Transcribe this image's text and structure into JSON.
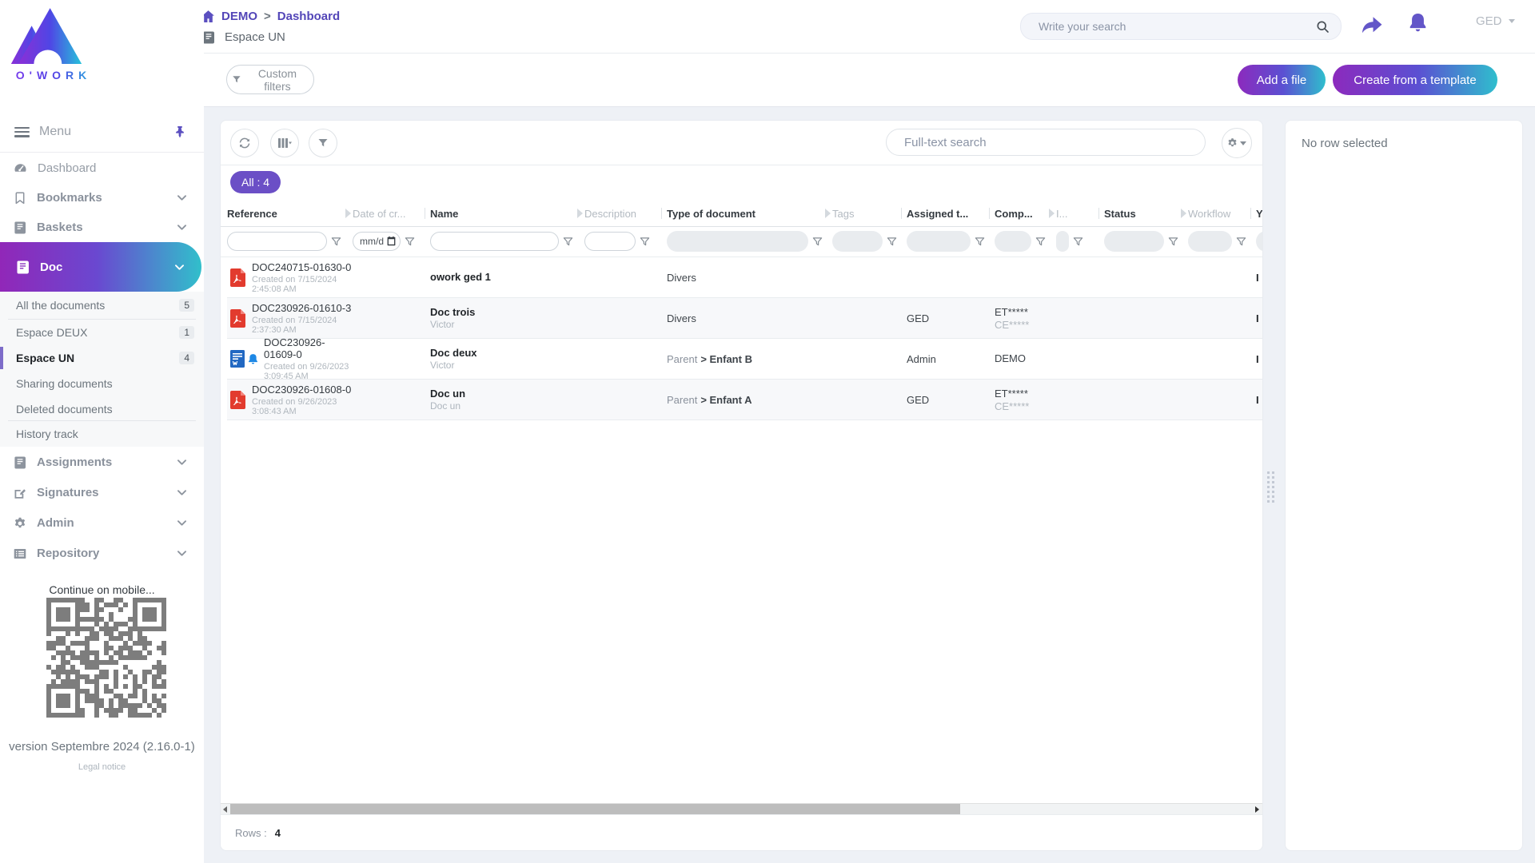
{
  "brand": {
    "name": "O'WORK"
  },
  "header": {
    "breadcrumb_root": "DEMO",
    "breadcrumb_sep": ">",
    "breadcrumb_current": "Dashboard",
    "space_name": "Espace UN",
    "top_search_placeholder": "Write your search",
    "user_menu_label": "GED",
    "custom_filters_label": "Custom filters",
    "add_file_label": "Add a file",
    "create_template_label": "Create from a template"
  },
  "sidebar": {
    "menu_label": "Menu",
    "items": [
      {
        "label": "Dashboard"
      },
      {
        "label": "Bookmarks"
      },
      {
        "label": "Baskets"
      },
      {
        "label": "Doc"
      },
      {
        "label": "Assignments"
      },
      {
        "label": "Signatures"
      },
      {
        "label": "Admin"
      },
      {
        "label": "Repository"
      }
    ],
    "doc_children": [
      {
        "label": "All the documents",
        "badge": "5"
      },
      {
        "label": "Espace DEUX",
        "badge": "1"
      },
      {
        "label": "Espace UN",
        "badge": "4"
      },
      {
        "label": "Sharing documents",
        "badge": ""
      },
      {
        "label": "Deleted documents",
        "badge": ""
      },
      {
        "label": "History track",
        "badge": ""
      }
    ],
    "mobile_text": "Continue on mobile...",
    "version_text": "version Septembre 2024 (2.16.0-1)",
    "legal_text": "Legal notice"
  },
  "toolbar": {
    "fulltext_placeholder": "Full-text search",
    "all_badge": "All : 4"
  },
  "table": {
    "columns": [
      {
        "label": "Reference"
      },
      {
        "label": "Date of cr..."
      },
      {
        "label": "Name"
      },
      {
        "label": "Description"
      },
      {
        "label": "Type of document"
      },
      {
        "label": "Tags"
      },
      {
        "label": "Assigned t..."
      },
      {
        "label": "Comp..."
      },
      {
        "label": "I..."
      },
      {
        "label": "Status"
      },
      {
        "label": "Workflow"
      },
      {
        "label": "Y..."
      }
    ],
    "date_filter_placeholder": "mm/d",
    "rows": [
      {
        "reference": "DOC240715-01630-0",
        "created": "Created on 7/15/2024 2:45:08 AM",
        "name": "owork ged 1",
        "name_sub": "",
        "type_prefix": "",
        "type_main": "Divers",
        "assigned": "",
        "comp_line1": "",
        "comp_line2": "",
        "edge_text": "I",
        "icon": "pdf-file-icon"
      },
      {
        "reference": "DOC230926-01610-3",
        "created": "Created on 7/15/2024 2:37:30 AM",
        "name": "Doc trois",
        "name_sub": "Victor",
        "type_prefix": "",
        "type_main": "Divers",
        "assigned": "GED",
        "comp_line1": "ET*****",
        "comp_line2": "CE*****",
        "edge_text": "I",
        "icon": "pdf-file-icon"
      },
      {
        "reference": "DOC230926-01609-0",
        "created": "Created on 9/26/2023 3:09:45 AM",
        "name": "Doc deux",
        "name_sub": "Victor",
        "type_prefix": "Parent",
        "type_main": "> Enfant B",
        "assigned": "Admin",
        "comp_line1": "DEMO",
        "comp_line2": "",
        "edge_text": "I",
        "icon": "word-file-icon with notification-bell-icon"
      },
      {
        "reference": "DOC230926-01608-0",
        "created": "Created on 9/26/2023 3:08:43 AM",
        "name": "Doc un",
        "name_sub": "Doc un",
        "type_prefix": "Parent",
        "type_main": "> Enfant A",
        "assigned": "GED",
        "comp_line1": "ET*****",
        "comp_line2": "CE*****",
        "edge_text": "I",
        "icon": "pdf-file-icon"
      }
    ]
  },
  "footer": {
    "rows_label": "Rows :",
    "rows_count": "4"
  },
  "details": {
    "empty_text": "No row selected"
  }
}
